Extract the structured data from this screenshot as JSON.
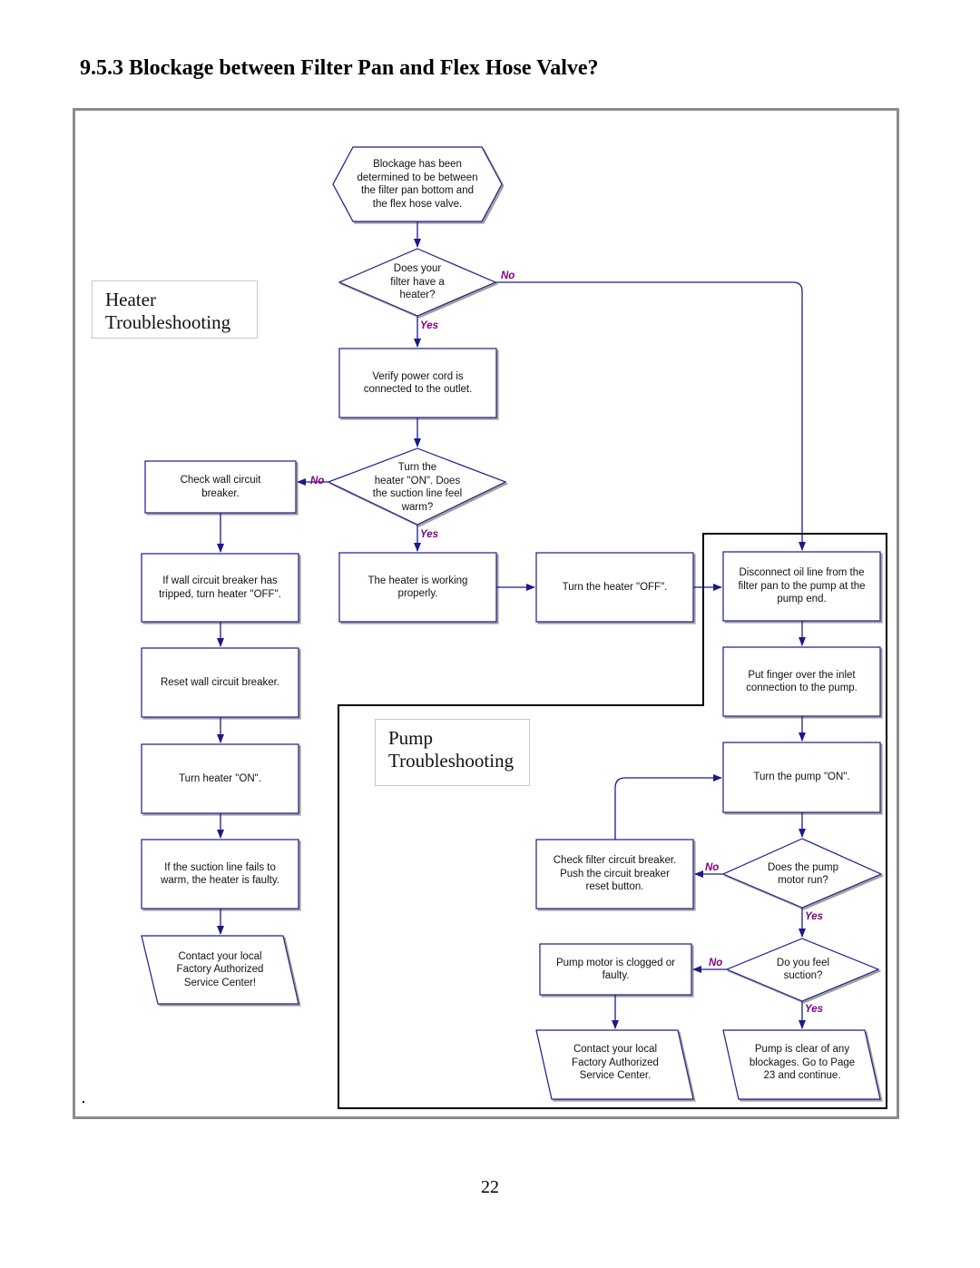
{
  "page": {
    "title": "9.5.3 Blockage between Filter Pan and Flex Hose Valve?",
    "page_number": "22"
  },
  "colors": {
    "node_stroke": "#1a1a8c",
    "edge_label": "#800080",
    "frame_border": "#8c8c8c",
    "pump_region_border": "#000000"
  },
  "sections": {
    "heater": "Heater\nTroubleshooting",
    "pump": "Pump\nTroubleshooting"
  },
  "nodes": {
    "start": "Blockage has been\ndetermined to be between\nthe filter pan bottom and\nthe flex hose valve.",
    "has_heater": "Does your\nfilter have a\nheater?",
    "verify_cord": "Verify power cord is\nconnected to the outlet.",
    "suction_warm": "Turn the\nheater \"ON\". Does\nthe suction line feel\nwarm?",
    "check_wall_breaker": "Check wall circuit\nbreaker.",
    "if_tripped": "If wall circuit breaker has\ntripped, turn heater \"OFF\".",
    "reset_wall_breaker": "Reset wall circuit breaker.",
    "turn_heater_on": "Turn heater \"ON\".",
    "heater_faulty": "If the suction line fails to\nwarm, the heater is faulty.",
    "contact_service_1": "Contact your local\nFactory Authorized\nService Center!",
    "heater_working": "The heater is working\nproperly.",
    "turn_heater_off": "Turn the heater \"OFF\".",
    "disconnect_oil_line": "Disconnect oil line from the\nfilter pan to the pump at the\npump end.",
    "finger_inlet": "Put finger over the inlet\nconnection to the pump.",
    "turn_pump_on": "Turn the pump \"ON\".",
    "pump_motor_run": "Does the pump\nmotor run?",
    "check_filter_breaker": "Check filter circuit breaker.\nPush the circuit breaker\nreset button.",
    "feel_suction": "Do you feel\nsuction?",
    "pump_clogged": "Pump motor is clogged or\nfaulty.",
    "contact_service_2": "Contact your local\nFactory Authorized\nService Center.",
    "pump_clear": "Pump is clear of any\nblockages.  Go to Page\n23 and continue."
  },
  "edge_labels": {
    "has_heater_no": "No",
    "has_heater_yes": "Yes",
    "suction_warm_no": "No",
    "suction_warm_yes": "Yes",
    "pump_motor_run_no": "No",
    "pump_motor_run_yes": "Yes",
    "feel_suction_no": "No",
    "feel_suction_yes": "Yes"
  }
}
